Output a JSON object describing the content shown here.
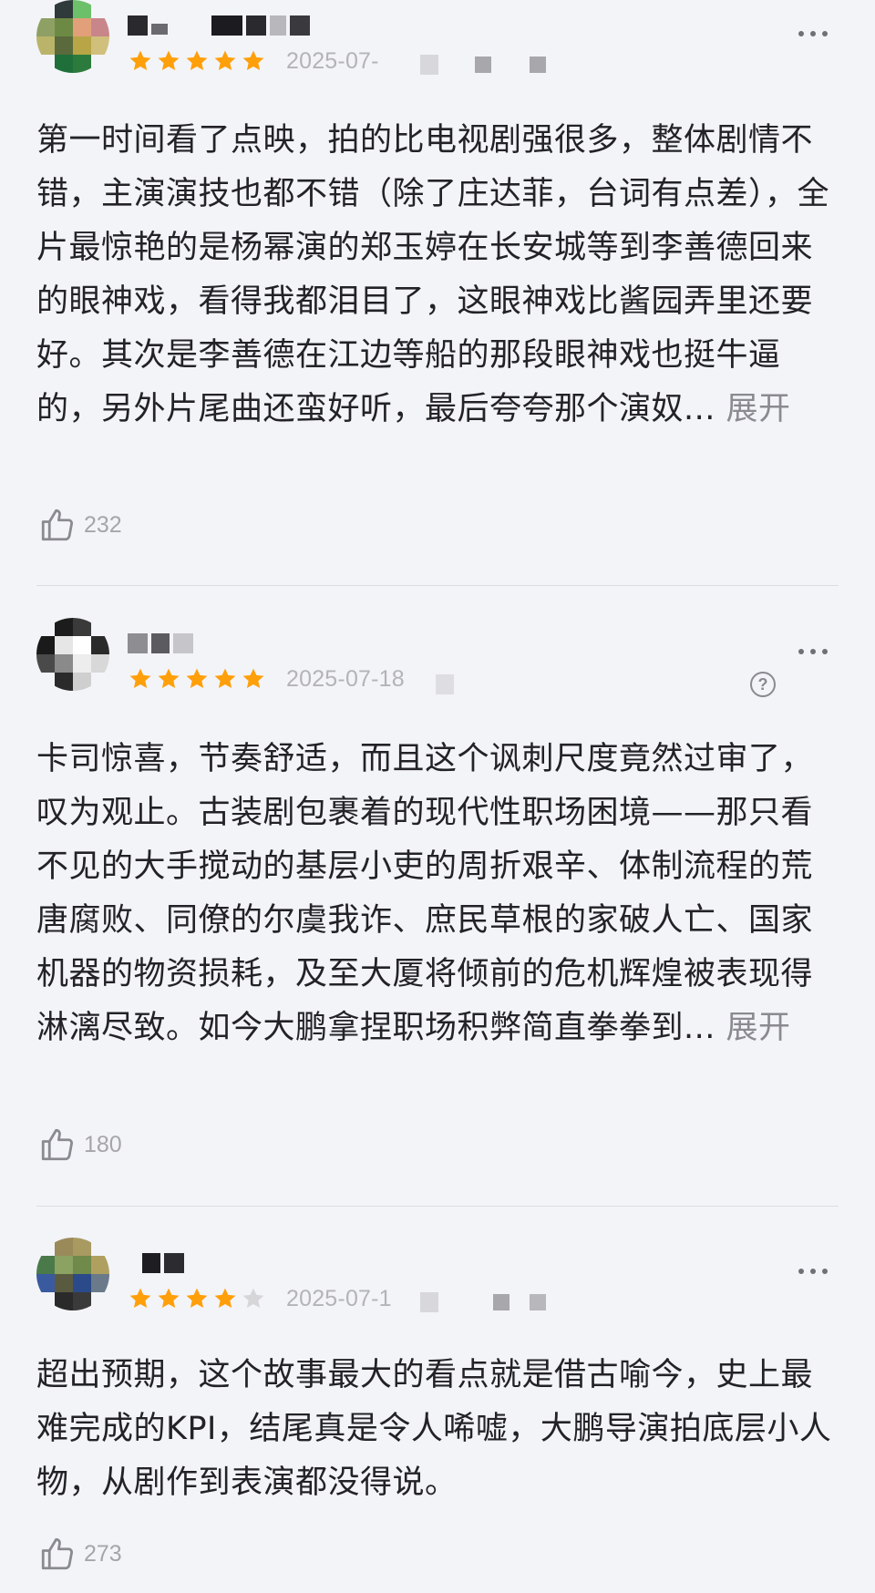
{
  "reviews": [
    {
      "date": "2025-07-",
      "rating": 5,
      "text": "第一时间看了点映，拍的比电视剧强很多，整体剧情不错，主演演技也都不错（除了庄达菲，台词有点差），全片最惊艳的是杨幂演的郑玉婷在长安城等到李善德回来的眼神戏，看得我都泪目了，这眼神戏比酱园弄里还要好。其次是李善德在江边等船的那段眼神戏也挺牛逼的，另外片尾曲还蛮好听，最后夸夸那个演奴...",
      "expand_label": "展开",
      "likes": "232"
    },
    {
      "date": "2025-07-18",
      "rating": 5,
      "text": "卡司惊喜，节奏舒适，而且这个讽刺尺度竟然过审了，叹为观止。古装剧包裹着的现代性职场困境——那只看不见的大手搅动的基层小吏的周折艰辛、体制流程的荒唐腐败、同僚的尔虞我诈、庶民草根的家破人亡、国家机器的物资损耗，及至大厦将倾前的危机辉煌被表现得淋漓尽致。如今大鹏拿捏职场积弊简直拳拳到...",
      "expand_label": "展开",
      "likes": "180"
    },
    {
      "date": "2025-07-1",
      "rating": 4,
      "text": "超出预期，这个故事最大的看点就是借古喻今，史上最难完成的KPI，结尾真是令人唏嘘，大鹏导演拍底层小人物，从剧作到表演都没得说。",
      "expand_label": "",
      "likes": "273"
    }
  ],
  "colors": {
    "star_filled": "#ff9f0a",
    "star_empty": "#d6d6d9",
    "background": "#f3f4f8",
    "text": "#232327",
    "meta": "#b3b3b8"
  },
  "icons": {
    "more": "more-dots-icon",
    "like": "thumbs-up-icon",
    "help": "question-circle-icon",
    "star": "star-icon"
  }
}
